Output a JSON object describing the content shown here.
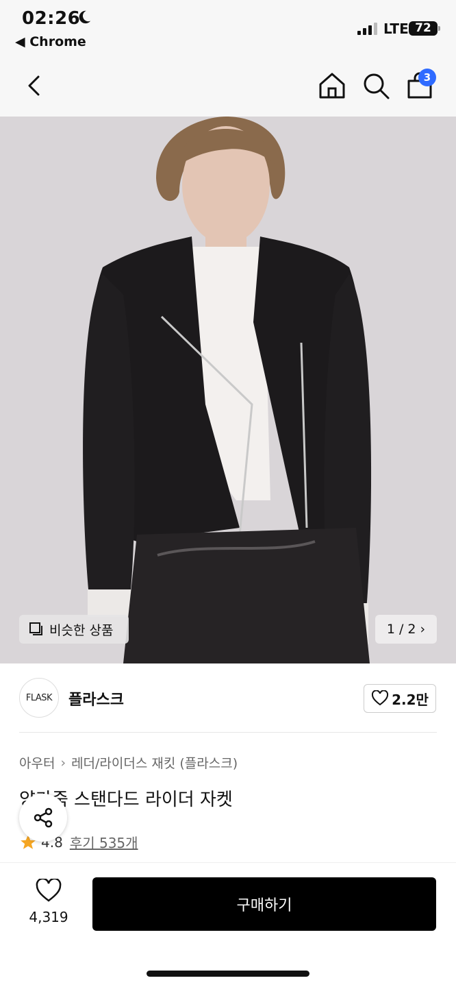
{
  "status_bar": {
    "time": "02:26",
    "back_app": "◀ Chrome",
    "network": "LTE",
    "battery": "72"
  },
  "nav": {
    "cart_count": "3"
  },
  "gallery": {
    "similar_label": "비슷한 상품",
    "pager": "1 / 2 ›"
  },
  "brand": {
    "logo_text": "FLASK",
    "name": "플라스크",
    "likes": "2.2만"
  },
  "product": {
    "category": "아우터",
    "subcategory": "레더/라이더스 재킷 (플라스크)",
    "title": "양가죽 스탠다드 라이더 자켓",
    "rating": "4.8",
    "reviews": "후기 535개"
  },
  "bottom_bar": {
    "wish_count": "4,319",
    "buy_label": "구매하기"
  },
  "colors": {
    "accent": "#2f6bff",
    "star": "#f5a623",
    "buy_button": "#000000"
  }
}
